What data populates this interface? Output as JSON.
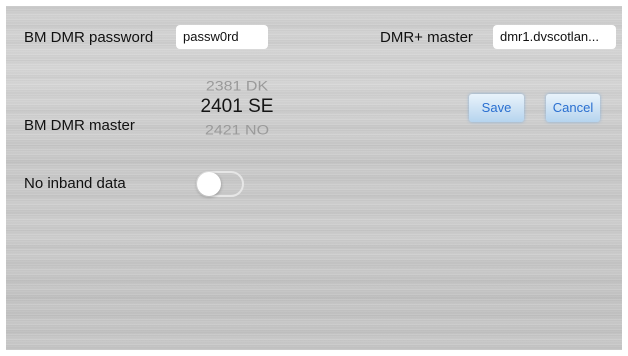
{
  "bm_dmr_password": {
    "label": "BM DMR password",
    "value": "passw0rd"
  },
  "dmr_plus_master": {
    "label": "DMR+ master",
    "value": "dmr1.dvscotlan..."
  },
  "bm_dmr_master": {
    "label": "BM DMR master",
    "options": [
      "2381 DK",
      "2401 SE",
      "2421 NO"
    ],
    "selected": "2401 SE"
  },
  "no_inband_data": {
    "label": "No inband data",
    "enabled": false
  },
  "buttons": {
    "save": "Save",
    "cancel": "Cancel"
  }
}
